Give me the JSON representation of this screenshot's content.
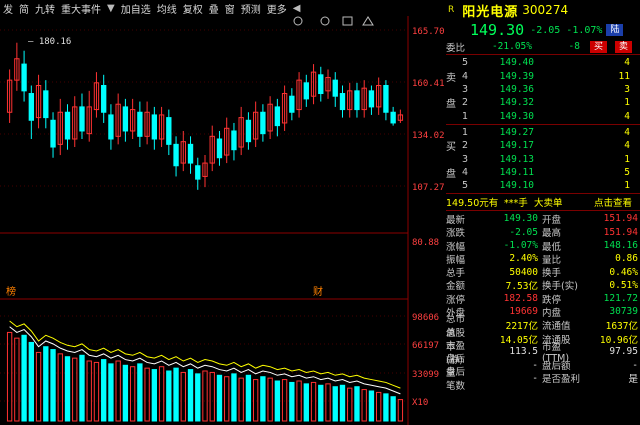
{
  "toolbar": {
    "items": [
      "发",
      "简",
      "九转",
      "重大事件"
    ],
    "items2": [
      "加自选",
      "均线",
      "复权",
      "叠",
      "窗",
      "预测",
      "更多"
    ]
  },
  "chart": {
    "price_axis": [
      "165.70",
      "160.41",
      "134.02",
      "107.27",
      "80.88"
    ],
    "vol_axis": [
      "98606",
      "66197",
      "33099",
      "X10"
    ],
    "max_price_label": "180.16",
    "markers": [
      "榜",
      "财"
    ],
    "colors": {
      "up": "#ff3232",
      "down": "#00ffff",
      "grid": "#8b0000",
      "ma": "#ffffff",
      "ma2": "#ffff00"
    }
  },
  "chart_data": {
    "type": "candlestick",
    "price_axis_ticks": [
      165.7,
      160.41,
      134.02,
      107.27,
      80.88
    ],
    "max_label": 180.16,
    "candles": [
      {
        "o": 150,
        "c": 162,
        "h": 166,
        "l": 146
      },
      {
        "o": 162,
        "c": 170,
        "h": 176,
        "l": 158
      },
      {
        "o": 168,
        "c": 158,
        "h": 173,
        "l": 154
      },
      {
        "o": 157,
        "c": 147,
        "h": 160,
        "l": 140
      },
      {
        "o": 148,
        "c": 160,
        "h": 164,
        "l": 144
      },
      {
        "o": 158,
        "c": 148,
        "h": 162,
        "l": 144
      },
      {
        "o": 147,
        "c": 137,
        "h": 150,
        "l": 133
      },
      {
        "o": 138,
        "c": 150,
        "h": 155,
        "l": 134
      },
      {
        "o": 150,
        "c": 140,
        "h": 153,
        "l": 136
      },
      {
        "o": 140,
        "c": 152,
        "h": 156,
        "l": 137
      },
      {
        "o": 152,
        "c": 143,
        "h": 157,
        "l": 140
      },
      {
        "o": 142,
        "c": 152,
        "h": 158,
        "l": 139
      },
      {
        "o": 151,
        "c": 161,
        "h": 165,
        "l": 148
      },
      {
        "o": 160,
        "c": 150,
        "h": 164,
        "l": 146
      },
      {
        "o": 149,
        "c": 140,
        "h": 153,
        "l": 136
      },
      {
        "o": 141,
        "c": 153,
        "h": 157,
        "l": 138
      },
      {
        "o": 152,
        "c": 143,
        "h": 155,
        "l": 139
      },
      {
        "o": 143,
        "c": 151,
        "h": 155,
        "l": 140
      },
      {
        "o": 150,
        "c": 141,
        "h": 154,
        "l": 137
      },
      {
        "o": 141,
        "c": 150,
        "h": 154,
        "l": 138
      },
      {
        "o": 149,
        "c": 140,
        "h": 152,
        "l": 136
      },
      {
        "o": 140,
        "c": 149,
        "h": 152,
        "l": 137
      },
      {
        "o": 148,
        "c": 138,
        "h": 151,
        "l": 134
      },
      {
        "o": 138,
        "c": 130,
        "h": 141,
        "l": 126
      },
      {
        "o": 131,
        "c": 139,
        "h": 143,
        "l": 128
      },
      {
        "o": 138,
        "c": 131,
        "h": 141,
        "l": 127
      },
      {
        "o": 130,
        "c": 125,
        "h": 133,
        "l": 121
      },
      {
        "o": 126,
        "c": 131,
        "h": 134,
        "l": 122
      },
      {
        "o": 131,
        "c": 141,
        "h": 145,
        "l": 128
      },
      {
        "o": 140,
        "c": 133,
        "h": 143,
        "l": 130
      },
      {
        "o": 134,
        "c": 144,
        "h": 148,
        "l": 131
      },
      {
        "o": 143,
        "c": 136,
        "h": 146,
        "l": 132
      },
      {
        "o": 137,
        "c": 148,
        "h": 152,
        "l": 134
      },
      {
        "o": 147,
        "c": 139,
        "h": 150,
        "l": 136
      },
      {
        "o": 140,
        "c": 150,
        "h": 154,
        "l": 137
      },
      {
        "o": 150,
        "c": 142,
        "h": 153,
        "l": 139
      },
      {
        "o": 143,
        "c": 153,
        "h": 156,
        "l": 140
      },
      {
        "o": 152,
        "c": 145,
        "h": 155,
        "l": 141
      },
      {
        "o": 146,
        "c": 157,
        "h": 160,
        "l": 143
      },
      {
        "o": 156,
        "c": 150,
        "h": 159,
        "l": 147
      },
      {
        "o": 151,
        "c": 162,
        "h": 165,
        "l": 148
      },
      {
        "o": 161,
        "c": 155,
        "h": 164,
        "l": 152
      },
      {
        "o": 156,
        "c": 165,
        "h": 168,
        "l": 153
      },
      {
        "o": 164,
        "c": 157,
        "h": 167,
        "l": 154
      },
      {
        "o": 158,
        "c": 163,
        "h": 166,
        "l": 155
      },
      {
        "o": 162,
        "c": 156,
        "h": 165,
        "l": 152
      },
      {
        "o": 157,
        "c": 151,
        "h": 160,
        "l": 148
      },
      {
        "o": 151,
        "c": 158,
        "h": 161,
        "l": 148
      },
      {
        "o": 158,
        "c": 151,
        "h": 161,
        "l": 148
      },
      {
        "o": 151,
        "c": 159,
        "h": 162,
        "l": 148
      },
      {
        "o": 158,
        "c": 152,
        "h": 160,
        "l": 149
      },
      {
        "o": 152,
        "c": 160,
        "h": 163,
        "l": 149
      },
      {
        "o": 160,
        "c": 150,
        "h": 162,
        "l": 147
      },
      {
        "o": 150,
        "c": 146,
        "h": 152,
        "l": 145
      },
      {
        "o": 147,
        "c": 149,
        "h": 151,
        "l": 146
      }
    ],
    "volumes": [
      62,
      58,
      60,
      55,
      48,
      52,
      50,
      47,
      45,
      44,
      46,
      42,
      41,
      43,
      40,
      42,
      39,
      38,
      40,
      37,
      36,
      38,
      35,
      37,
      34,
      36,
      33,
      35,
      34,
      32,
      31,
      33,
      30,
      32,
      29,
      31,
      30,
      28,
      29,
      27,
      28,
      26,
      27,
      25,
      26,
      24,
      25,
      23,
      24,
      22,
      21,
      20,
      19,
      17,
      15
    ]
  },
  "stock": {
    "r": "R",
    "name": "阳光电源",
    "code": "300274",
    "price": "149.30",
    "change": "-2.05",
    "pct": "-1.07%",
    "tag_lu": "陆",
    "weibi_lbl": "委比",
    "weibi": "-21.05%",
    "weicha": "-8",
    "buy_btn": "买",
    "sell_btn": "卖"
  },
  "book": {
    "sell_side": "卖盘",
    "buy_side": "买盘",
    "sells": [
      {
        "lvl": "5",
        "price": "149.40",
        "vol": "4"
      },
      {
        "lvl": "4",
        "price": "149.39",
        "vol": "11"
      },
      {
        "lvl": "3",
        "price": "149.36",
        "vol": "3"
      },
      {
        "lvl": "2",
        "price": "149.32",
        "vol": "1"
      },
      {
        "lvl": "1",
        "price": "149.30",
        "vol": "4"
      }
    ],
    "buys": [
      {
        "lvl": "1",
        "price": "149.27",
        "vol": "4"
      },
      {
        "lvl": "2",
        "price": "149.17",
        "vol": "4"
      },
      {
        "lvl": "3",
        "price": "149.13",
        "vol": "1"
      },
      {
        "lvl": "4",
        "price": "149.11",
        "vol": "5"
      },
      {
        "lvl": "5",
        "price": "149.10",
        "vol": "1"
      }
    ]
  },
  "lastline": {
    "price": "149.50元有",
    "mask": "***手",
    "btn1": "大卖单",
    "btn2": "点击查看"
  },
  "quote": [
    {
      "l1": "最新",
      "v1": "149.30",
      "c1": "g",
      "l2": "开盘",
      "v2": "151.94",
      "c2": "r"
    },
    {
      "l1": "涨跌",
      "v1": "-2.05",
      "c1": "g",
      "l2": "最高",
      "v2": "151.94",
      "c2": "r"
    },
    {
      "l1": "涨幅",
      "v1": "-1.07%",
      "c1": "g",
      "l2": "最低",
      "v2": "148.16",
      "c2": "g"
    },
    {
      "l1": "振幅",
      "v1": "2.40%",
      "c1": "y",
      "l2": "量比",
      "v2": "0.86",
      "c2": "y"
    },
    {
      "l1": "总手",
      "v1": "50400",
      "c1": "y",
      "l2": "换手",
      "v2": "0.46%",
      "c2": "y"
    },
    {
      "l1": "金额",
      "v1": "7.53亿",
      "c1": "y",
      "l2": "换手(实)",
      "v2": "0.51%",
      "c2": "y"
    },
    {
      "l1": "涨停",
      "v1": "182.58",
      "c1": "r",
      "l2": "跌停",
      "v2": "121.72",
      "c2": "g"
    },
    {
      "l1": "外盘",
      "v1": "19669",
      "c1": "r",
      "l2": "内盘",
      "v2": "30739",
      "c2": "g"
    },
    {
      "l1": "总市值",
      "v1": "2217亿",
      "c1": "y",
      "l2": "流通值",
      "v2": "1637亿",
      "c2": "y"
    },
    {
      "l1": "总股本",
      "v1": "14.05亿",
      "c1": "y",
      "l2": "流通股",
      "v2": "10.96亿",
      "c2": "y"
    },
    {
      "l1": "市盈(静)",
      "v1": "113.5",
      "c1": "w",
      "l2": "市盈(TTM)",
      "v2": "97.95",
      "c2": "w"
    },
    {
      "l1": "盘后量",
      "v1": "-",
      "c1": "w",
      "l2": "盘后额",
      "v2": "-",
      "c2": "w"
    },
    {
      "l1": "盘后笔数",
      "v1": "-",
      "c1": "w",
      "l2": "是否盈利",
      "v2": "是",
      "c2": "w"
    }
  ]
}
